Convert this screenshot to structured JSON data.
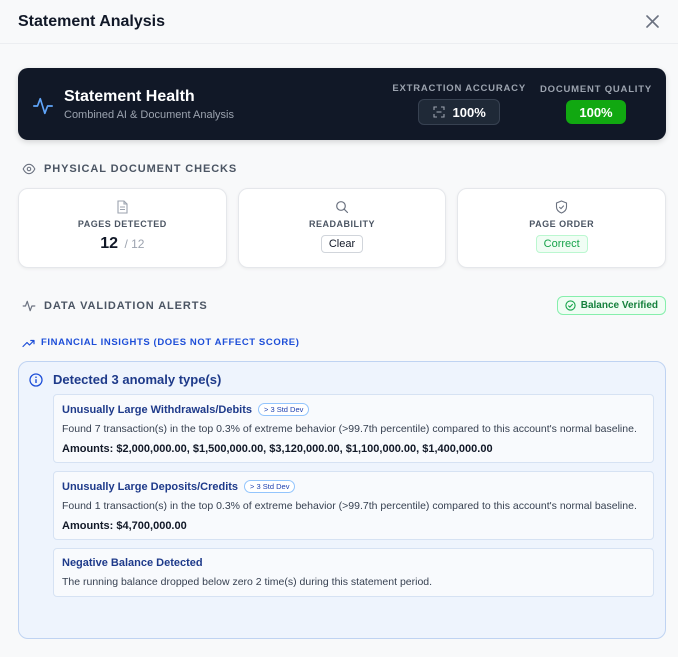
{
  "modal": {
    "title": "Statement Analysis",
    "close_icon": "close-icon"
  },
  "health": {
    "title": "Statement Health",
    "subtitle": "Combined AI & Document Analysis",
    "accuracy_label": "EXTRACTION ACCURACY",
    "accuracy_value": "100%",
    "quality_label": "DOCUMENT QUALITY",
    "quality_value": "100%",
    "quality_color": "#11a811",
    "icon": "activity-icon"
  },
  "physical": {
    "heading": "PHYSICAL DOCUMENT CHECKS",
    "pages": {
      "label": "PAGES DETECTED",
      "value": "12",
      "of": "/ 12"
    },
    "readability": {
      "label": "READABILITY",
      "value": "Clear"
    },
    "order": {
      "label": "PAGE ORDER",
      "value": "Correct"
    }
  },
  "alerts": {
    "heading": "DATA VALIDATION ALERTS",
    "badge": "Balance Verified"
  },
  "insights": {
    "heading": "FINANCIAL INSIGHTS (DOES NOT AFFECT SCORE)",
    "summary": "Detected 3 anomaly type(s)",
    "items": [
      {
        "title": "Unusually Large Withdrawals/Debits",
        "badge": "> 3 Std Dev",
        "desc": "Found 7 transaction(s) in the top 0.3% of extreme behavior (>99.7th percentile) compared to this account's normal baseline.",
        "amounts": "Amounts: $2,000,000.00, $1,500,000.00, $3,120,000.00, $1,100,000.00, $1,400,000.00"
      },
      {
        "title": "Unusually Large Deposits/Credits",
        "badge": "> 3 Std Dev",
        "desc": "Found 1 transaction(s) in the top 0.3% of extreme behavior (>99.7th percentile) compared to this account's normal baseline.",
        "amounts": "Amounts: $4,700,000.00"
      },
      {
        "title": "Negative Balance Detected",
        "desc": "The running balance dropped below zero 2 time(s) during this statement period."
      }
    ]
  }
}
